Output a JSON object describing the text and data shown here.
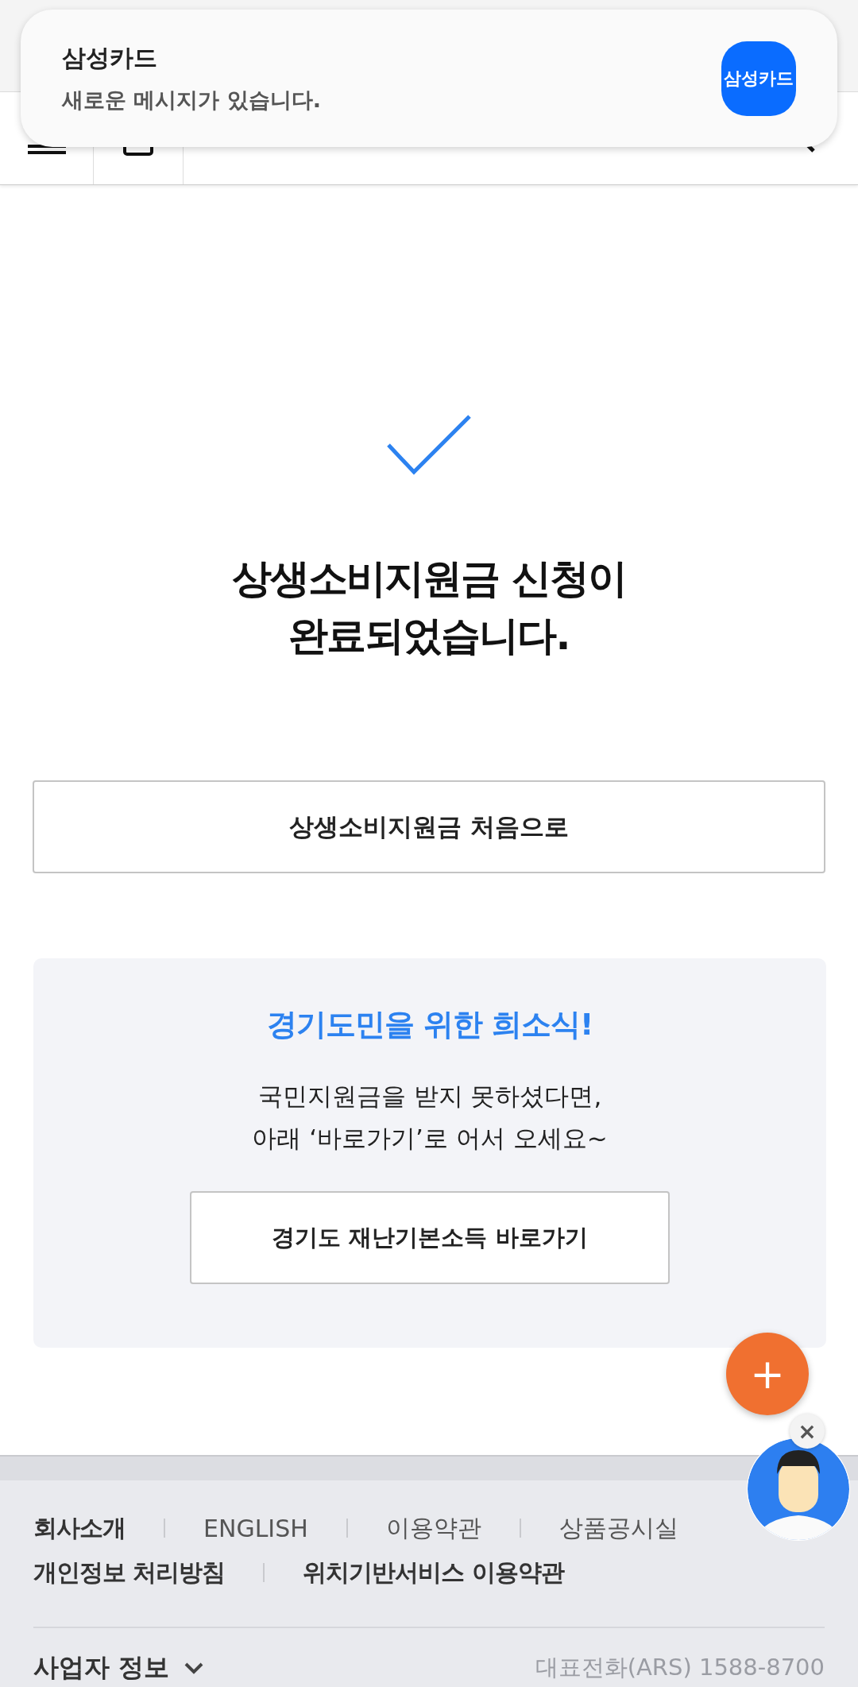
{
  "notification": {
    "app": "삼성카드",
    "message": "새로운 메시지가 있습니다.",
    "icon_label": "삼성카드"
  },
  "complete": {
    "title_lines": [
      "상생소비지원금 신청이",
      "완료되었습니다."
    ]
  },
  "home_button": "상생소비지원금 처음으로",
  "promo": {
    "title": "경기도민을 위한 희소식!",
    "lines": [
      "국민지원금을 받지 못하셨다면,",
      "아래 ‘바로가기’로 어서 오세요~"
    ],
    "button": "경기도 재난기본소득 바로가기"
  },
  "fab": {
    "label": "+"
  },
  "chatbot": {
    "close": "×"
  },
  "footer": {
    "links": [
      [
        {
          "label": "회사소개",
          "kind": "strong"
        },
        {
          "label": "ENGLISH",
          "kind": "plain"
        },
        {
          "label": "이용약관",
          "kind": "plain"
        },
        {
          "label": "상품공시실",
          "kind": "plain"
        }
      ],
      [
        {
          "label": "개인정보 처리방침",
          "kind": "strong"
        },
        {
          "label": "위치기반서비스 이용약관",
          "kind": "strong"
        }
      ]
    ],
    "business_info": "사업자 정보",
    "phone": "대표전화(ARS) 1588-8700"
  }
}
